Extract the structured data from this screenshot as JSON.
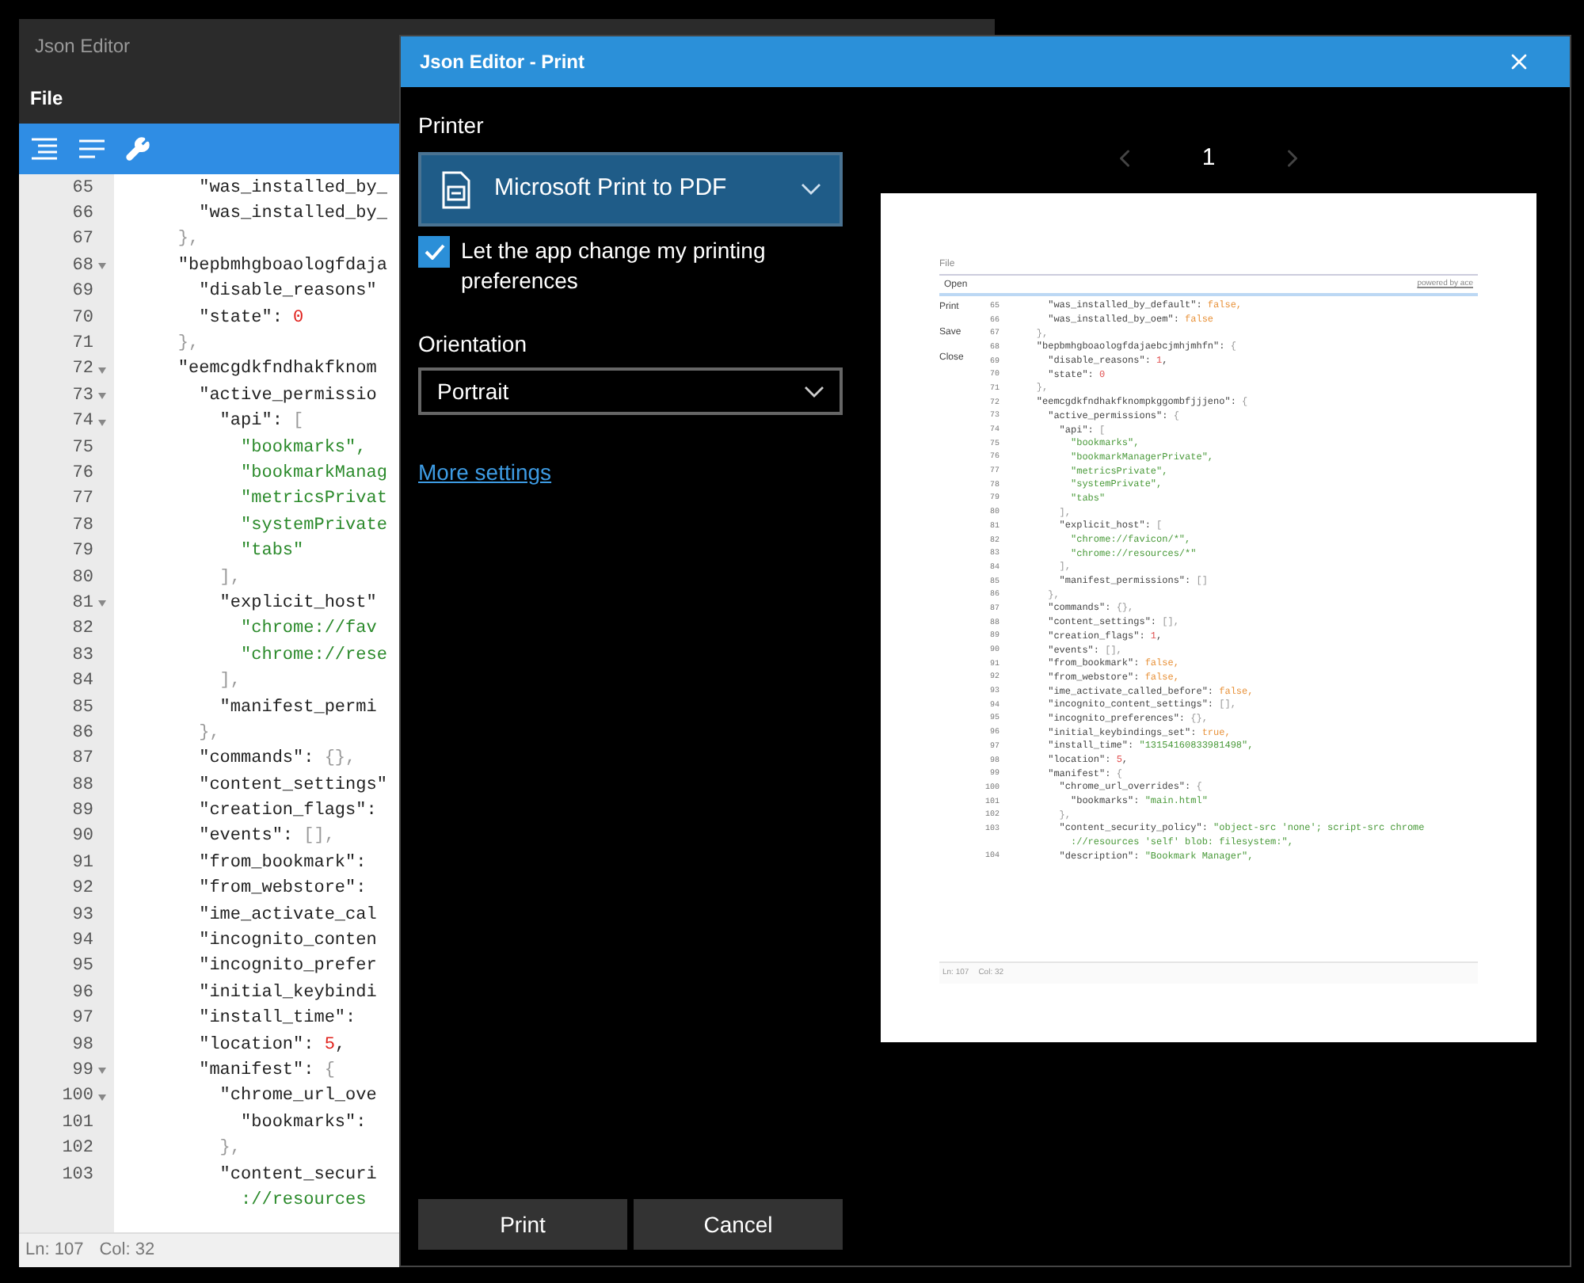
{
  "editor": {
    "title": "Json Editor",
    "menu": [
      "File"
    ],
    "lines": [
      {
        "number": "65",
        "foldable": false,
        "tokens": [
          {
            "kind": "key",
            "text": "      \"was_installed_by_"
          }
        ]
      },
      {
        "number": "66",
        "foldable": false,
        "tokens": [
          {
            "kind": "key",
            "text": "      \"was_installed_by_"
          }
        ]
      },
      {
        "number": "67",
        "foldable": false,
        "tokens": [
          {
            "kind": "punct",
            "text": "    },"
          }
        ]
      },
      {
        "number": "68",
        "foldable": true,
        "tokens": [
          {
            "kind": "key",
            "text": "    \"bepbmhgboaologfdaja"
          }
        ]
      },
      {
        "number": "69",
        "foldable": false,
        "tokens": [
          {
            "kind": "key",
            "text": "      \"disable_reasons\""
          }
        ]
      },
      {
        "number": "70",
        "foldable": false,
        "tokens": [
          {
            "kind": "key",
            "text": "      \"state\": "
          },
          {
            "kind": "number",
            "text": "0"
          }
        ]
      },
      {
        "number": "71",
        "foldable": false,
        "tokens": [
          {
            "kind": "punct",
            "text": "    },"
          }
        ]
      },
      {
        "number": "72",
        "foldable": true,
        "tokens": [
          {
            "kind": "key",
            "text": "    \"eemcgdkfndhakfknom"
          }
        ]
      },
      {
        "number": "73",
        "foldable": true,
        "tokens": [
          {
            "kind": "key",
            "text": "      \"active_permissio"
          }
        ]
      },
      {
        "number": "74",
        "foldable": true,
        "tokens": [
          {
            "kind": "key",
            "text": "        \"api\": "
          },
          {
            "kind": "punct",
            "text": "["
          }
        ]
      },
      {
        "number": "75",
        "foldable": false,
        "tokens": [
          {
            "kind": "string",
            "text": "          \"bookmarks\","
          }
        ]
      },
      {
        "number": "76",
        "foldable": false,
        "tokens": [
          {
            "kind": "string",
            "text": "          \"bookmarkManag"
          }
        ]
      },
      {
        "number": "77",
        "foldable": false,
        "tokens": [
          {
            "kind": "string",
            "text": "          \"metricsPrivat"
          }
        ]
      },
      {
        "number": "78",
        "foldable": false,
        "tokens": [
          {
            "kind": "string",
            "text": "          \"systemPrivate"
          }
        ]
      },
      {
        "number": "79",
        "foldable": false,
        "tokens": [
          {
            "kind": "string",
            "text": "          \"tabs\""
          }
        ]
      },
      {
        "number": "80",
        "foldable": false,
        "tokens": [
          {
            "kind": "punct",
            "text": "        ],"
          }
        ]
      },
      {
        "number": "81",
        "foldable": true,
        "tokens": [
          {
            "kind": "key",
            "text": "        \"explicit_host\""
          }
        ]
      },
      {
        "number": "82",
        "foldable": false,
        "tokens": [
          {
            "kind": "string",
            "text": "          \"chrome://fav"
          }
        ]
      },
      {
        "number": "83",
        "foldable": false,
        "tokens": [
          {
            "kind": "string",
            "text": "          \"chrome://rese"
          }
        ]
      },
      {
        "number": "84",
        "foldable": false,
        "tokens": [
          {
            "kind": "punct",
            "text": "        ],"
          }
        ]
      },
      {
        "number": "85",
        "foldable": false,
        "tokens": [
          {
            "kind": "key",
            "text": "        \"manifest_permi"
          }
        ]
      },
      {
        "number": "86",
        "foldable": false,
        "tokens": [
          {
            "kind": "punct",
            "text": "      },"
          }
        ]
      },
      {
        "number": "87",
        "foldable": false,
        "tokens": [
          {
            "kind": "key",
            "text": "      \"commands\": "
          },
          {
            "kind": "punct",
            "text": "{},"
          }
        ]
      },
      {
        "number": "88",
        "foldable": false,
        "tokens": [
          {
            "kind": "key",
            "text": "      \"content_settings\""
          }
        ]
      },
      {
        "number": "89",
        "foldable": false,
        "tokens": [
          {
            "kind": "key",
            "text": "      \"creation_flags\":"
          }
        ]
      },
      {
        "number": "90",
        "foldable": false,
        "tokens": [
          {
            "kind": "key",
            "text": "      \"events\": "
          },
          {
            "kind": "punct",
            "text": "[],"
          }
        ]
      },
      {
        "number": "91",
        "foldable": false,
        "tokens": [
          {
            "kind": "key",
            "text": "      \"from_bookmark\":"
          }
        ]
      },
      {
        "number": "92",
        "foldable": false,
        "tokens": [
          {
            "kind": "key",
            "text": "      \"from_webstore\":"
          }
        ]
      },
      {
        "number": "93",
        "foldable": false,
        "tokens": [
          {
            "kind": "key",
            "text": "      \"ime_activate_cal"
          }
        ]
      },
      {
        "number": "94",
        "foldable": false,
        "tokens": [
          {
            "kind": "key",
            "text": "      \"incognito_conten"
          }
        ]
      },
      {
        "number": "95",
        "foldable": false,
        "tokens": [
          {
            "kind": "key",
            "text": "      \"incognito_prefer"
          }
        ]
      },
      {
        "number": "96",
        "foldable": false,
        "tokens": [
          {
            "kind": "key",
            "text": "      \"initial_keybindi"
          }
        ]
      },
      {
        "number": "97",
        "foldable": false,
        "tokens": [
          {
            "kind": "key",
            "text": "      \"install_time\":"
          }
        ]
      },
      {
        "number": "98",
        "foldable": false,
        "tokens": [
          {
            "kind": "key",
            "text": "      \"location\": "
          },
          {
            "kind": "number",
            "text": "5"
          },
          {
            "kind": "key",
            "text": ","
          }
        ]
      },
      {
        "number": "99",
        "foldable": true,
        "tokens": [
          {
            "kind": "key",
            "text": "      \"manifest\": "
          },
          {
            "kind": "punct",
            "text": "{"
          }
        ]
      },
      {
        "number": "100",
        "foldable": true,
        "tokens": [
          {
            "kind": "key",
            "text": "        \"chrome_url_ove"
          }
        ]
      },
      {
        "number": "101",
        "foldable": false,
        "tokens": [
          {
            "kind": "key",
            "text": "          \"bookmarks\":"
          }
        ]
      },
      {
        "number": "102",
        "foldable": false,
        "tokens": [
          {
            "kind": "punct",
            "text": "        },"
          }
        ]
      },
      {
        "number": "103",
        "foldable": false,
        "tokens": [
          {
            "kind": "key",
            "text": "        \"content_securi"
          }
        ]
      },
      {
        "foldable": false,
        "tokens": [
          {
            "kind": "string",
            "text": "          ://resources"
          }
        ]
      }
    ],
    "status": {
      "line": "Ln: 107",
      "column": "Col: 32"
    }
  },
  "print_dialog": {
    "title": "Json Editor - Print",
    "printer_label": "Printer",
    "printer": "Microsoft Print to PDF",
    "let_app_change": {
      "label": "Let the app change my printing preferences",
      "checked": true
    },
    "orientation_label": "Orientation",
    "orientation": "Portrait",
    "more_settings": "More settings",
    "page_number": "1",
    "preview": {
      "menu": "File",
      "open_item": "Open",
      "powered_by": "powered by ace",
      "menu_items": [
        "Print",
        "Save",
        "Close"
      ],
      "lines": [
        {
          "number": "65",
          "tokens": [
            {
              "kind": "key",
              "text": "      \"was_installed_by_default\": "
            },
            {
              "kind": "bool",
              "text": "false,"
            }
          ]
        },
        {
          "number": "66",
          "tokens": [
            {
              "kind": "key",
              "text": "      \"was_installed_by_oem\": "
            },
            {
              "kind": "bool",
              "text": "false"
            }
          ]
        },
        {
          "number": "67",
          "tokens": [
            {
              "kind": "punct",
              "text": "    },"
            }
          ]
        },
        {
          "number": "68",
          "tokens": [
            {
              "kind": "key",
              "text": "    \"bepbmhgboaologfdajaebcjmhjmhfn\": "
            },
            {
              "kind": "punct",
              "text": "{"
            }
          ]
        },
        {
          "number": "69",
          "tokens": [
            {
              "kind": "key",
              "text": "      \"disable_reasons\": "
            },
            {
              "kind": "number",
              "text": "1"
            },
            {
              "kind": "key",
              "text": ","
            }
          ]
        },
        {
          "number": "70",
          "tokens": [
            {
              "kind": "key",
              "text": "      \"state\": "
            },
            {
              "kind": "number",
              "text": "0"
            }
          ]
        },
        {
          "number": "71",
          "tokens": [
            {
              "kind": "punct",
              "text": "    },"
            }
          ]
        },
        {
          "number": "72",
          "tokens": [
            {
              "kind": "key",
              "text": "    \"eemcgdkfndhakfknompkggombfjjjeno\": "
            },
            {
              "kind": "punct",
              "text": "{"
            }
          ]
        },
        {
          "number": "73",
          "tokens": [
            {
              "kind": "key",
              "text": "      \"active_permissions\": "
            },
            {
              "kind": "punct",
              "text": "{"
            }
          ]
        },
        {
          "number": "74",
          "tokens": [
            {
              "kind": "key",
              "text": "        \"api\": "
            },
            {
              "kind": "punct",
              "text": "["
            }
          ]
        },
        {
          "number": "75",
          "tokens": [
            {
              "kind": "string",
              "text": "          \"bookmarks\","
            }
          ]
        },
        {
          "number": "76",
          "tokens": [
            {
              "kind": "string",
              "text": "          \"bookmarkManagerPrivate\","
            }
          ]
        },
        {
          "number": "77",
          "tokens": [
            {
              "kind": "string",
              "text": "          \"metricsPrivate\","
            }
          ]
        },
        {
          "number": "78",
          "tokens": [
            {
              "kind": "string",
              "text": "          \"systemPrivate\","
            }
          ]
        },
        {
          "number": "79",
          "tokens": [
            {
              "kind": "string",
              "text": "          \"tabs\""
            }
          ]
        },
        {
          "number": "80",
          "tokens": [
            {
              "kind": "punct",
              "text": "        ],"
            }
          ]
        },
        {
          "number": "81",
          "tokens": [
            {
              "kind": "key",
              "text": "        \"explicit_host\": "
            },
            {
              "kind": "punct",
              "text": "["
            }
          ]
        },
        {
          "number": "82",
          "tokens": [
            {
              "kind": "string",
              "text": "          \"chrome://favicon/*\","
            }
          ]
        },
        {
          "number": "83",
          "tokens": [
            {
              "kind": "string",
              "text": "          \"chrome://resources/*\""
            }
          ]
        },
        {
          "number": "84",
          "tokens": [
            {
              "kind": "punct",
              "text": "        ],"
            }
          ]
        },
        {
          "number": "85",
          "tokens": [
            {
              "kind": "key",
              "text": "        \"manifest_permissions\": "
            },
            {
              "kind": "punct",
              "text": "[]"
            }
          ]
        },
        {
          "number": "86",
          "tokens": [
            {
              "kind": "punct",
              "text": "      },"
            }
          ]
        },
        {
          "number": "87",
          "tokens": [
            {
              "kind": "key",
              "text": "      \"commands\": "
            },
            {
              "kind": "punct",
              "text": "{},"
            }
          ]
        },
        {
          "number": "88",
          "tokens": [
            {
              "kind": "key",
              "text": "      \"content_settings\": "
            },
            {
              "kind": "punct",
              "text": "[],"
            }
          ]
        },
        {
          "number": "89",
          "tokens": [
            {
              "kind": "key",
              "text": "      \"creation_flags\": "
            },
            {
              "kind": "number",
              "text": "1"
            },
            {
              "kind": "key",
              "text": ","
            }
          ]
        },
        {
          "number": "90",
          "tokens": [
            {
              "kind": "key",
              "text": "      \"events\": "
            },
            {
              "kind": "punct",
              "text": "[],"
            }
          ]
        },
        {
          "number": "91",
          "tokens": [
            {
              "kind": "key",
              "text": "      \"from_bookmark\": "
            },
            {
              "kind": "bool",
              "text": "false,"
            }
          ]
        },
        {
          "number": "92",
          "tokens": [
            {
              "kind": "key",
              "text": "      \"from_webstore\": "
            },
            {
              "kind": "bool",
              "text": "false,"
            }
          ]
        },
        {
          "number": "93",
          "tokens": [
            {
              "kind": "key",
              "text": "      \"ime_activate_called_before\": "
            },
            {
              "kind": "bool",
              "text": "false,"
            }
          ]
        },
        {
          "number": "94",
          "tokens": [
            {
              "kind": "key",
              "text": "      \"incognito_content_settings\": "
            },
            {
              "kind": "punct",
              "text": "[],"
            }
          ]
        },
        {
          "number": "95",
          "tokens": [
            {
              "kind": "key",
              "text": "      \"incognito_preferences\": "
            },
            {
              "kind": "punct",
              "text": "{},"
            }
          ]
        },
        {
          "number": "96",
          "tokens": [
            {
              "kind": "key",
              "text": "      \"initial_keybindings_set\": "
            },
            {
              "kind": "bool",
              "text": "true,"
            }
          ]
        },
        {
          "number": "97",
          "tokens": [
            {
              "kind": "key",
              "text": "      \"install_time\": "
            },
            {
              "kind": "string",
              "text": "\"13154160833981498\","
            }
          ]
        },
        {
          "number": "98",
          "tokens": [
            {
              "kind": "key",
              "text": "      \"location\": "
            },
            {
              "kind": "number",
              "text": "5"
            },
            {
              "kind": "key",
              "text": ","
            }
          ]
        },
        {
          "number": "99",
          "tokens": [
            {
              "kind": "key",
              "text": "      \"manifest\": "
            },
            {
              "kind": "punct",
              "text": "{"
            }
          ]
        },
        {
          "number": "100",
          "tokens": [
            {
              "kind": "key",
              "text": "        \"chrome_url_overrides\": "
            },
            {
              "kind": "punct",
              "text": "{"
            }
          ]
        },
        {
          "number": "101",
          "tokens": [
            {
              "kind": "key",
              "text": "          \"bookmarks\": "
            },
            {
              "kind": "string",
              "text": "\"main.html\""
            }
          ]
        },
        {
          "number": "102",
          "tokens": [
            {
              "kind": "punct",
              "text": "        },"
            }
          ]
        },
        {
          "number": "103",
          "tokens": [
            {
              "kind": "key",
              "text": "        \"content_security_policy\": "
            },
            {
              "kind": "string",
              "text": "\"object-src 'none'; script-src chrome"
            }
          ]
        },
        {
          "tokens": [
            {
              "kind": "string",
              "text": "          ://resources 'self' blob: filesystem:\","
            }
          ]
        },
        {
          "number": "104",
          "tokens": [
            {
              "kind": "key",
              "text": "        \"description\": "
            },
            {
              "kind": "string",
              "text": "\"Bookmark Manager\","
            }
          ]
        }
      ],
      "status": {
        "line": "Ln: 107",
        "column": "Col: 32"
      }
    },
    "buttons": [
      "Print",
      "Cancel"
    ]
  }
}
